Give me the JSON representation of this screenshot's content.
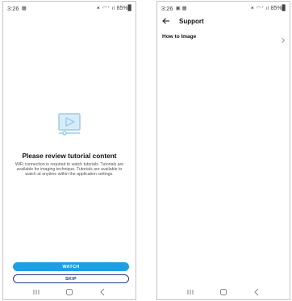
{
  "left_screen": {
    "status": {
      "time": "3:26",
      "indicator": "▦",
      "signal": "✶ ◠⁺ ıl",
      "battery": "85%▊"
    },
    "tutorial": {
      "title": "Please review tutorial content",
      "description": "WiFi connection is required to watch tutorials. Tutorials are available for imaging technique. Tutorials are available to watch at anytime within the application settings."
    },
    "buttons": {
      "watch": "WATCH",
      "skip": "SKIP"
    },
    "icons": [
      "play-video-icon"
    ],
    "accent": "#1e9fe3",
    "skip_color": "#27368a"
  },
  "right_screen": {
    "status": {
      "time": "3:26",
      "indicator": "▣ ▦",
      "signal": "✶ ◠⁺ ıl",
      "battery": "85%▊"
    },
    "header": {
      "title": "Support"
    },
    "items": [
      {
        "label": "How to Image"
      }
    ]
  },
  "nav_icons": [
    "recent-apps-icon",
    "home-icon",
    "back-icon"
  ]
}
